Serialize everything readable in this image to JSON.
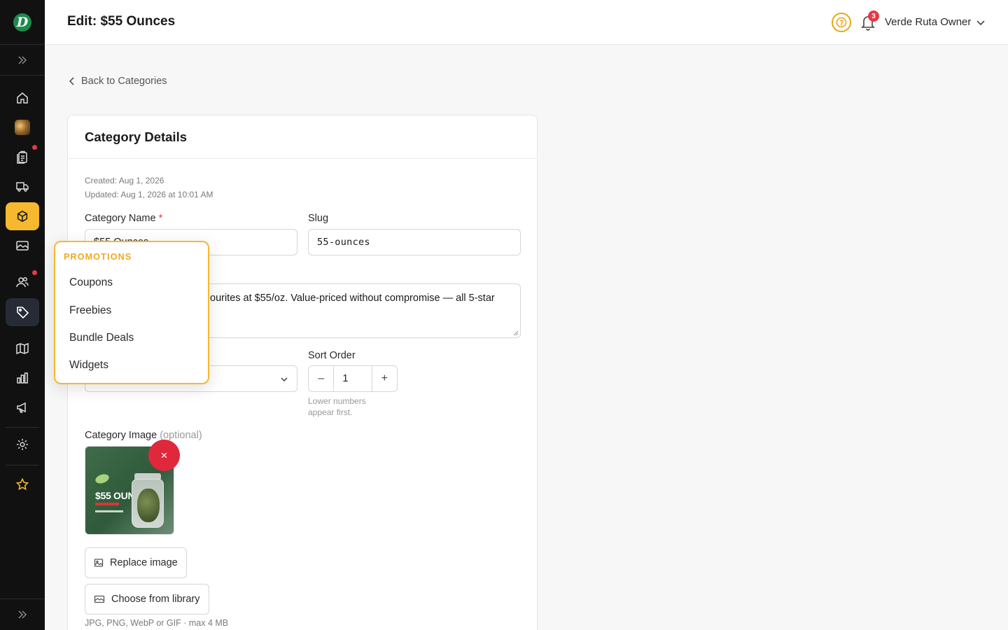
{
  "header": {
    "title": "Edit: $55 Ounces",
    "notification_count": "3",
    "user_name": "Verde Ruta Owner"
  },
  "sidebar": {
    "logo_letter": "D",
    "items": [
      {
        "icon": "home-icon"
      },
      {
        "icon": "product-thumbnail-icon"
      },
      {
        "icon": "orders-clipboard-icon",
        "has_alert": true
      },
      {
        "icon": "delivery-truck-icon"
      },
      {
        "icon": "box-icon",
        "active": true
      },
      {
        "icon": "image-gallery-icon"
      },
      {
        "icon": "users-icon",
        "has_alert": true
      },
      {
        "icon": "tag-icon",
        "selected": true
      },
      {
        "icon": "map-icon"
      },
      {
        "icon": "bar-chart-icon"
      },
      {
        "icon": "megaphone-icon"
      },
      {
        "icon": "gear-icon"
      },
      {
        "icon": "star-icon"
      }
    ]
  },
  "nav": {
    "back_label": "Back to Categories"
  },
  "card": {
    "title": "Category Details",
    "created": "Created: Aug 1, 2026",
    "updated": "Updated: Aug 1, 2026 at 10:01 AM",
    "name_label": "Category Name",
    "required_mark": "*",
    "name_value": "$55 Ounces",
    "slug_label": "Slug",
    "slug_value": "55-ounces",
    "description_visible": "ourites at $55/oz. Value-priced without compromise — all 5-star",
    "sort_label": "Sort Order",
    "sort_minus": "–",
    "sort_value": "1",
    "sort_plus": "+",
    "sort_hint_1": "Lower numbers",
    "sort_hint_2": "appear first.",
    "image_label": "Category Image",
    "image_optional": "(optional)",
    "image_text": "$55 OUNCES",
    "remove_label": "×",
    "replace_label": "Replace image",
    "library_label": "Choose from library",
    "file_hint": "JPG, PNG, WebP or GIF · max 4 MB"
  },
  "flyout": {
    "heading": "PROMOTIONS",
    "items": [
      "Coupons",
      "Freebies",
      "Bundle Deals",
      "Widgets"
    ]
  },
  "colors": {
    "accent": "#f5b82e",
    "sidebar_bg": "#111111",
    "danger": "#e0283c"
  }
}
